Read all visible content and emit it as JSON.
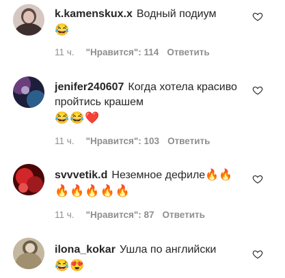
{
  "comments": [
    {
      "username": "k.kamenskux.x",
      "text": "Водный подиум",
      "emojis": "😂",
      "time": "11 ч.",
      "likes": "\"Нравится\": 114",
      "reply": "Ответить",
      "avatar_colors": [
        "#c9b8b2",
        "#5b4a47"
      ]
    },
    {
      "username": "jenifer240607",
      "text": "Когда хотела красиво пройтись крашем",
      "emojis": "😂😂❤️",
      "time": "11 ч.",
      "likes": "\"Нравится\": 103",
      "reply": "Ответить",
      "avatar_colors": [
        "#1d1f3a",
        "#6a3e7d"
      ]
    },
    {
      "username": "svvvetik.d",
      "text": "Неземное дефиле🔥🔥",
      "emojis": "🔥🔥🔥🔥🔥",
      "time": "11 ч.",
      "likes": "\"Нравится\": 87",
      "reply": "Ответить",
      "avatar_colors": [
        "#7a0d0d",
        "#d2262a"
      ]
    },
    {
      "username": "ilona_kokar",
      "text": "Ушла по английски",
      "emojis": "😂😍",
      "time": "",
      "likes": "",
      "reply": "",
      "avatar_colors": [
        "#c4b8a0",
        "#6b5f4a"
      ]
    }
  ]
}
